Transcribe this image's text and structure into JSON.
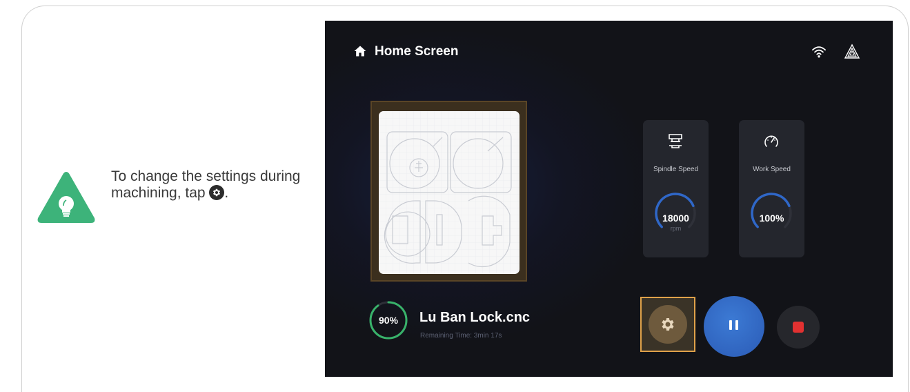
{
  "tip": {
    "text_before": "To change the settings during machining, tap ",
    "text_after": ".",
    "icon": "lightbulb-icon",
    "accent_color": "#3db37a"
  },
  "screen": {
    "header": {
      "title": "Home Screen",
      "home_icon": "home-icon",
      "wifi_icon": "wifi-icon",
      "logo_icon": "brand-logo-icon"
    },
    "job": {
      "file_name": "Lu Ban Lock.cnc",
      "remaining_time": "Remaining Time: 3min 17s",
      "progress_label": "90%",
      "progress": 0.9,
      "progress_color": "#38b26a"
    },
    "spindle": {
      "label": "Spindle Speed",
      "value": "18000",
      "unit": "rpm",
      "level": 0.75,
      "icon": "spindle-icon"
    },
    "work": {
      "label": "Work Speed",
      "value": "100%",
      "level": 0.75,
      "icon": "speedometer-icon"
    },
    "controls": {
      "settings_icon": "gear-icon",
      "pause_icon": "pause-icon",
      "stop_icon": "stop-icon",
      "accent_color": "#2f67c8",
      "stop_color": "#e23131",
      "highlight_color": "#e0a24a"
    }
  }
}
